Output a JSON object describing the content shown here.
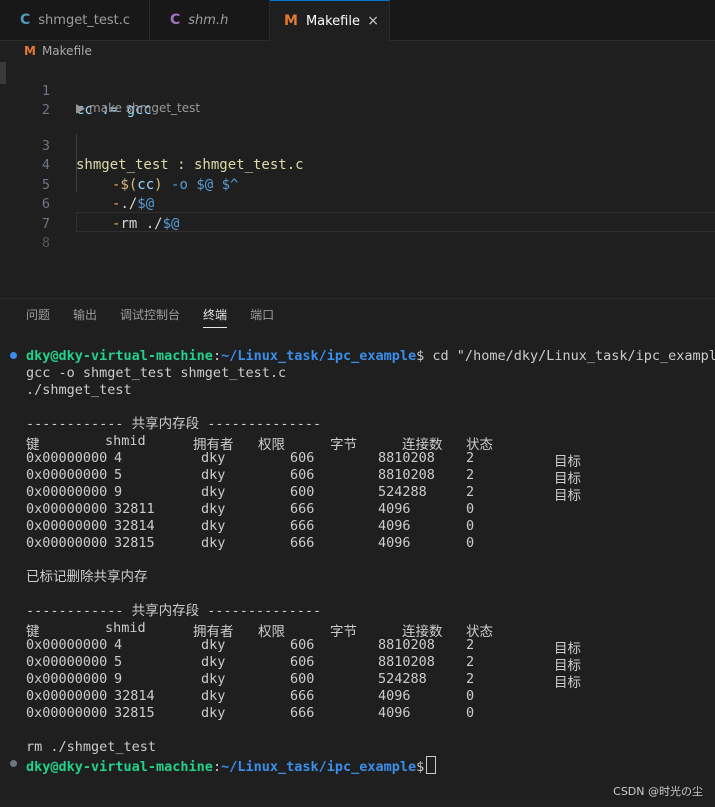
{
  "tabs": [
    {
      "icon": "C",
      "label": "shmget_test.c",
      "active": false
    },
    {
      "icon": "C",
      "label": "shm.h",
      "active": false
    },
    {
      "icon": "M",
      "label": "Makefile",
      "active": true
    }
  ],
  "close_glyph": "×",
  "breadcrumb": {
    "icon": "M",
    "label": "Makefile"
  },
  "editor": {
    "line_numbers": [
      "1",
      "2",
      "3",
      "4",
      "5",
      "6",
      "7",
      "8"
    ],
    "codelens": "▶ make shmget_test",
    "l1": {
      "a": "cc := gcc"
    },
    "l3": {
      "a": "shmget_test : shmget_test.c"
    },
    "l4": {
      "dash": "-",
      "d1": "$(",
      "v": "cc",
      "d2": ")",
      "b": " -o ",
      "d3": "$@ $^"
    },
    "l5": {
      "dash": "-",
      "a": "./",
      "d": "$@"
    },
    "l6": {
      "dash": "-",
      "a": "rm ./",
      "d": "$@"
    }
  },
  "panel_tabs": [
    "问题",
    "输出",
    "调试控制台",
    "终端",
    "端口"
  ],
  "terminal": {
    "prompt_user": "dky@dky-virtual-machine",
    "prompt_path": "~/Linux_task/ipc_example",
    "cmd1": " cd \"/home/dky/Linux_task/ipc_example",
    "out_gcc": "gcc -o shmget_test shmget_test.c",
    "out_run": "./shmget_test",
    "seg_title": "------------ 共享内存段 --------------",
    "headers": [
      "键",
      "shmid",
      "拥有者",
      "权限",
      "字节",
      "连接数",
      "状态"
    ],
    "table1": [
      [
        "0x00000000",
        "4",
        "dky",
        "606",
        "8810208",
        "2",
        "目标"
      ],
      [
        "0x00000000",
        "5",
        "dky",
        "606",
        "8810208",
        "2",
        "目标"
      ],
      [
        "0x00000000",
        "9",
        "dky",
        "600",
        "524288",
        "2",
        "目标"
      ],
      [
        "0x00000000",
        "32811",
        "dky",
        "666",
        "4096",
        "0",
        ""
      ],
      [
        "0x00000000",
        "32814",
        "dky",
        "666",
        "4096",
        "0",
        ""
      ],
      [
        "0x00000000",
        "32815",
        "dky",
        "666",
        "4096",
        "0",
        ""
      ]
    ],
    "marked": "已标记删除共享内存",
    "table2": [
      [
        "0x00000000",
        "4",
        "dky",
        "606",
        "8810208",
        "2",
        "目标"
      ],
      [
        "0x00000000",
        "5",
        "dky",
        "606",
        "8810208",
        "2",
        "目标"
      ],
      [
        "0x00000000",
        "9",
        "dky",
        "600",
        "524288",
        "2",
        "目标"
      ],
      [
        "0x00000000",
        "32814",
        "dky",
        "666",
        "4096",
        "0",
        ""
      ],
      [
        "0x00000000",
        "32815",
        "dky",
        "666",
        "4096",
        "0",
        ""
      ]
    ],
    "out_rm": "rm ./shmget_test"
  },
  "watermark": "CSDN @时光の尘",
  "colors": {
    "accent": "#0078d4",
    "prompt_user": "#23d18b",
    "prompt_path": "#3b8eea",
    "dot_done": "#3b8eea",
    "dot_idle": "#6e7681"
  }
}
